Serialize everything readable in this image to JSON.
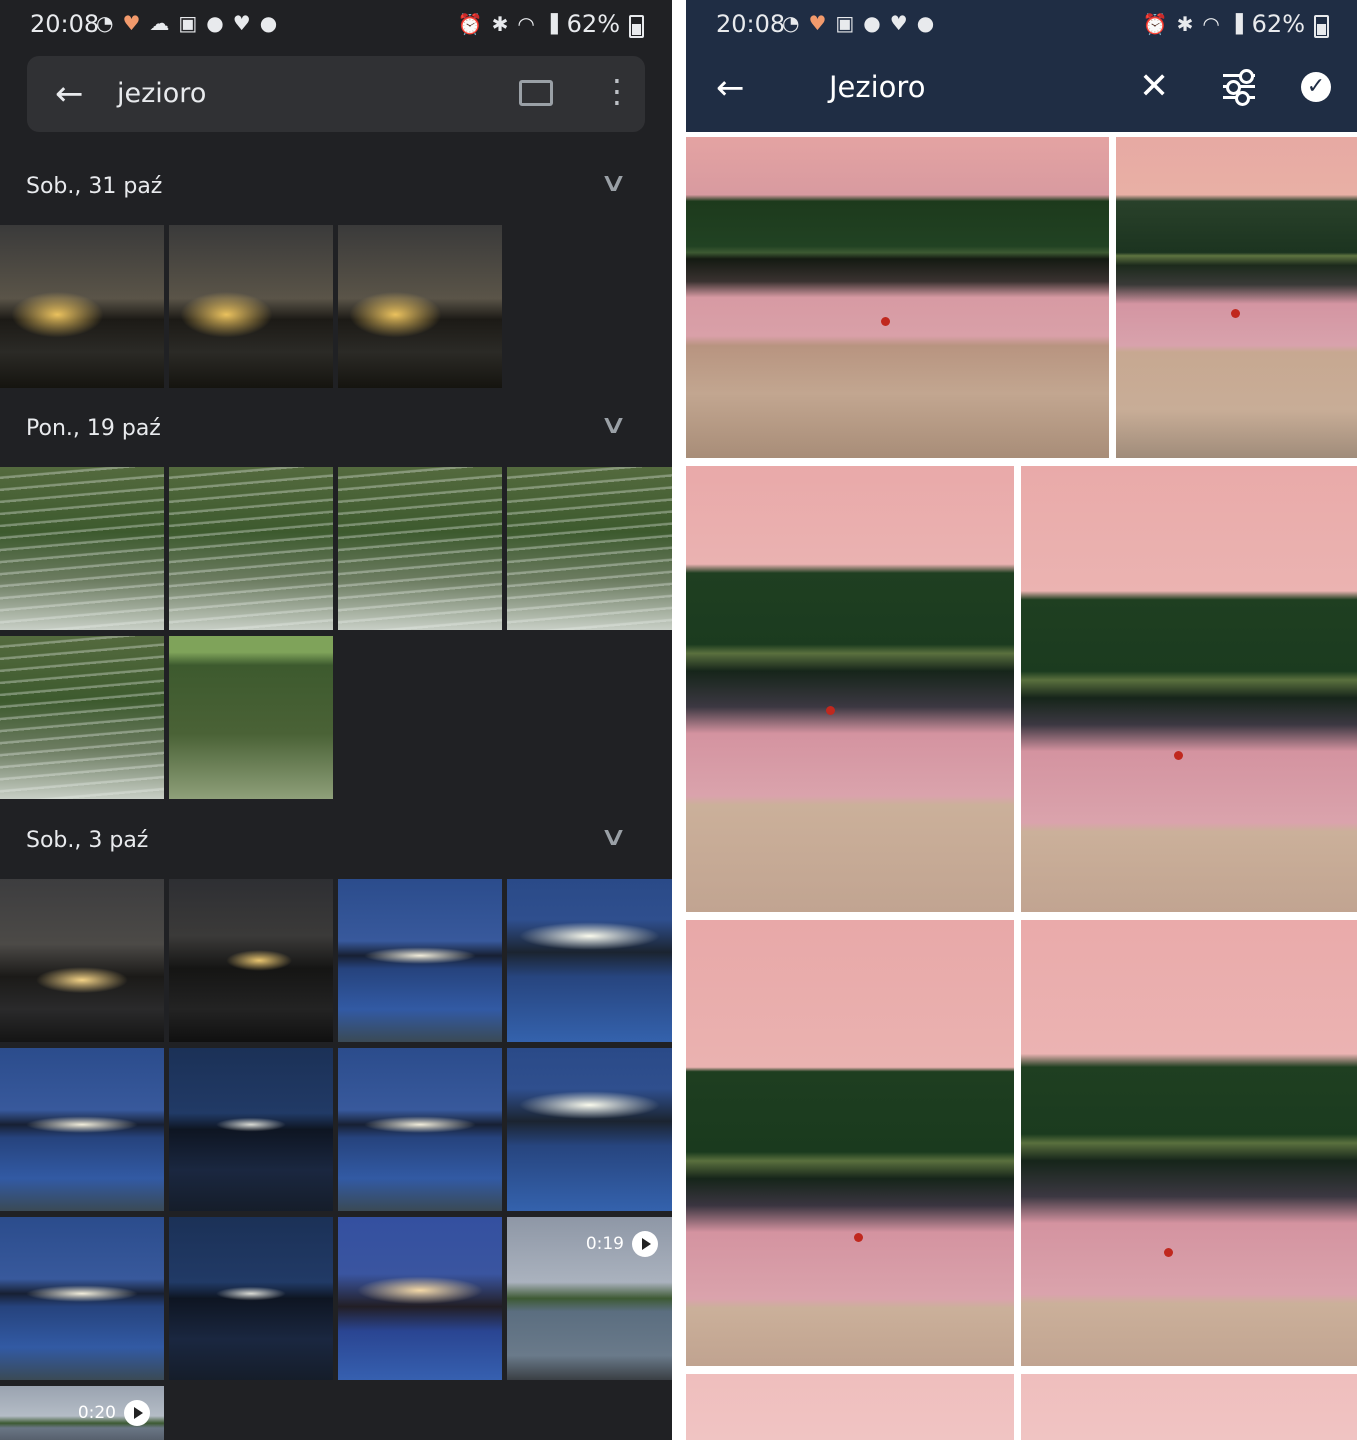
{
  "status_bar": {
    "time": "20:08",
    "battery": "62%",
    "notification_icons": [
      "messenger-icon",
      "heart-rate-icon",
      "cloud-upload-icon",
      "gallery-icon",
      "chat-bubble-icon",
      "heart-icon",
      "chat-bubble-icon"
    ],
    "system_icons": [
      "alarm-icon",
      "bluetooth-icon",
      "wifi-icon",
      "signal-icon",
      "battery-icon"
    ]
  },
  "left_app": {
    "search": {
      "query": "jezioro",
      "back_icon": "arrow-back-icon",
      "cast_icon": "cast-icon",
      "more_icon": "more-vert-icon"
    },
    "sections": [
      {
        "date": "Sob., 31 paź",
        "photo_count": 3
      },
      {
        "date": "Pon., 19 paź",
        "photo_count": 6
      },
      {
        "date": "Sob., 3 paź",
        "photo_count": 13
      }
    ],
    "videos": [
      {
        "duration": "0:19"
      },
      {
        "duration": "0:20"
      }
    ]
  },
  "right_app": {
    "appbar": {
      "title": "Jezioro",
      "back_icon": "arrow-back-icon",
      "close_icon": "close-icon",
      "filter_icon": "tune-sliders-icon",
      "confirm_icon": "check-circle-icon"
    }
  },
  "colors": {
    "left_background": "#202124",
    "search_bar": "#303134",
    "right_appbar": "#1f2d44"
  }
}
